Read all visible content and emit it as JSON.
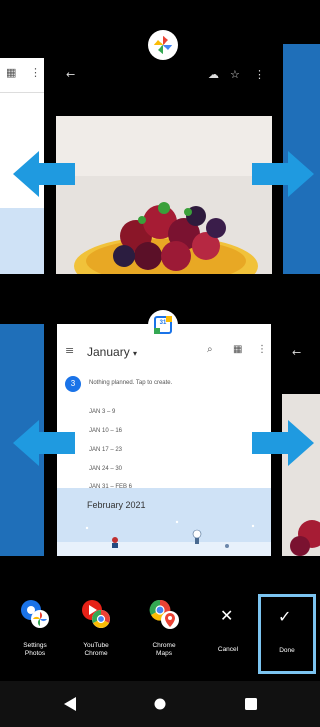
{
  "recents_top": {
    "photos_icon": "google-photos-icon",
    "right_strip_color": "#1f6fb9"
  },
  "recents_bottom": {
    "calendar_icon": "google-calendar-icon",
    "calendar": {
      "month_label": "January",
      "today_number": "3",
      "empty_text": "Nothing planned. Tap to create.",
      "weeks": [
        "JAN 3 – 9",
        "JAN 10 – 16",
        "JAN 17 – 23",
        "JAN 24 – 30",
        "JAN 31 – FEB 6"
      ],
      "next_month": "February 2021",
      "calendar_badge_num": "31"
    }
  },
  "app_pairs": [
    {
      "line1": "Settings",
      "line2": "Photos"
    },
    {
      "line1": "YouTube",
      "line2": "Chrome"
    },
    {
      "line1": "Chrome",
      "line2": "Maps"
    }
  ],
  "actions": {
    "cancel_label": "Cancel",
    "done_label": "Done"
  },
  "colors": {
    "accent_blue": "#1f9ae0",
    "done_outline": "#7cc4f0"
  }
}
